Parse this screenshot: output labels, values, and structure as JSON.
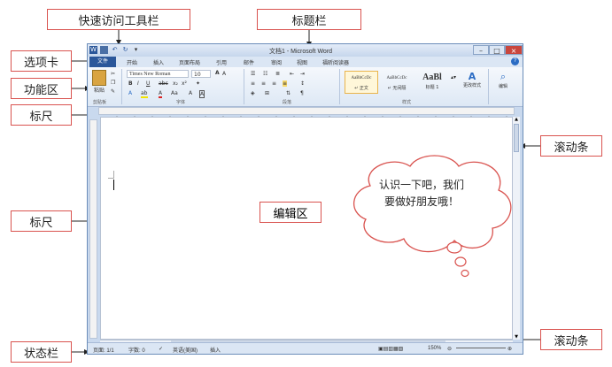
{
  "labels": {
    "quick_access_toolbar": "快速访问工具栏",
    "title_bar": "标题栏",
    "tabs": "选项卡",
    "ribbon": "功能区",
    "ruler_top": "标尺",
    "ruler_left": "标尺",
    "edit_area": "编辑区",
    "scrollbar_right": "滚动条",
    "scrollbar_bottom": "滚动条",
    "status_bar": "状态栏"
  },
  "bubble": {
    "line1": "认识一下吧，我们",
    "line2": "要做好朋友哦！"
  },
  "window": {
    "title": "文档1 - Microsoft Word",
    "tabs": [
      "文件",
      "开始",
      "插入",
      "页面布局",
      "引用",
      "邮件",
      "审阅",
      "视图",
      "福昕阅读器"
    ],
    "ribbon": {
      "clipboard": {
        "paste": "粘贴",
        "group": "剪贴板"
      },
      "font": {
        "name": "Times New Roman",
        "size": "10",
        "group": "字体"
      },
      "paragraph": {
        "group": "段落"
      },
      "styles": {
        "s1_preview": "AaBbCcDc",
        "s1_name": "↵ 正文",
        "s2_preview": "AaBbCcDc",
        "s2_name": "↵ 无间隔",
        "s3_preview": "AaBl",
        "s3_name": "标题 1",
        "change": "更改样式",
        "group": "样式"
      },
      "editing": {
        "label": "编辑"
      }
    },
    "status": {
      "page": "页面: 1/1",
      "words": "字数: 0",
      "lang": "英语(美国)",
      "mode": "插入",
      "zoom": "150%"
    }
  },
  "colors": {
    "label_border": "#d9534f",
    "file_tab": "#2b579a",
    "window_frame": "#c9d9ee"
  }
}
